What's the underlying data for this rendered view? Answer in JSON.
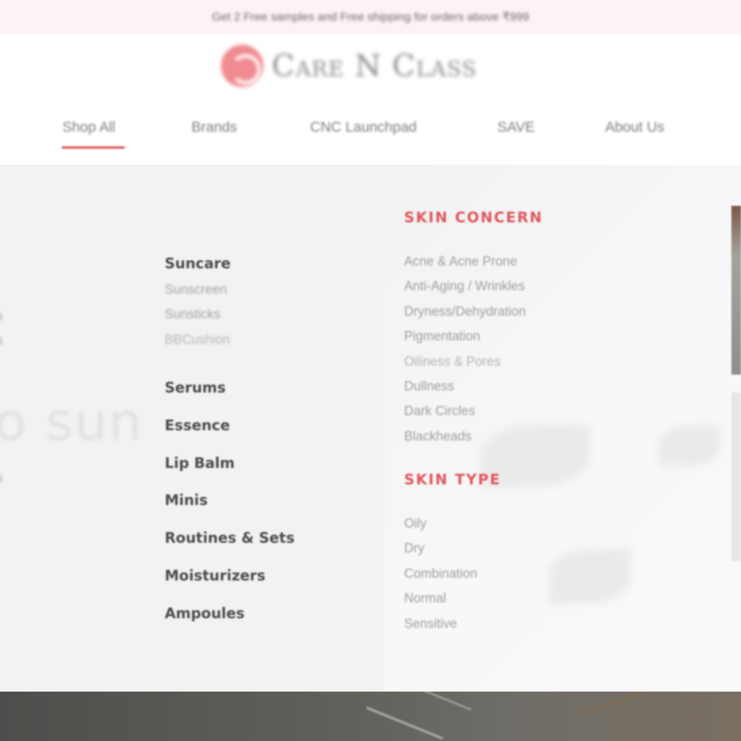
{
  "announcement": "Get 2 Free samples and Free shipping for orders above ₹999",
  "brand": {
    "name": "Care N Class",
    "accent_color": "#e0575d"
  },
  "nav": {
    "items": [
      {
        "label": "Shop All",
        "active": true
      },
      {
        "label": "Brands"
      },
      {
        "label": "CNC Launchpad"
      },
      {
        "label": "SAVE"
      },
      {
        "label": "About Us"
      }
    ]
  },
  "mega_menu": {
    "left_fragments": [
      "s",
      "s",
      "o sun",
      "s"
    ],
    "suncare": {
      "heading": "Suncare",
      "items": [
        "Sunscreen",
        "Sunsticks",
        "BBCushion"
      ]
    },
    "categories": [
      "Serums",
      "Essence",
      "Lip Balm",
      "Minis",
      "Routines & Sets",
      "Moisturizers",
      "Ampoules"
    ],
    "skin_concern": {
      "heading": "SKIN CONCERN",
      "items": [
        "Acne & Acne Prone",
        "Anti-Aging / Wrinkles",
        "Dryness/Dehydration",
        "Pigmentation",
        "Oiliness & Pores",
        "Dullness",
        "Dark Circles",
        "Blackheads"
      ]
    },
    "skin_type": {
      "heading": "SKIN TYPE",
      "items": [
        "Oily",
        "Dry",
        "Combination",
        "Normal",
        "Sensitive"
      ]
    }
  }
}
